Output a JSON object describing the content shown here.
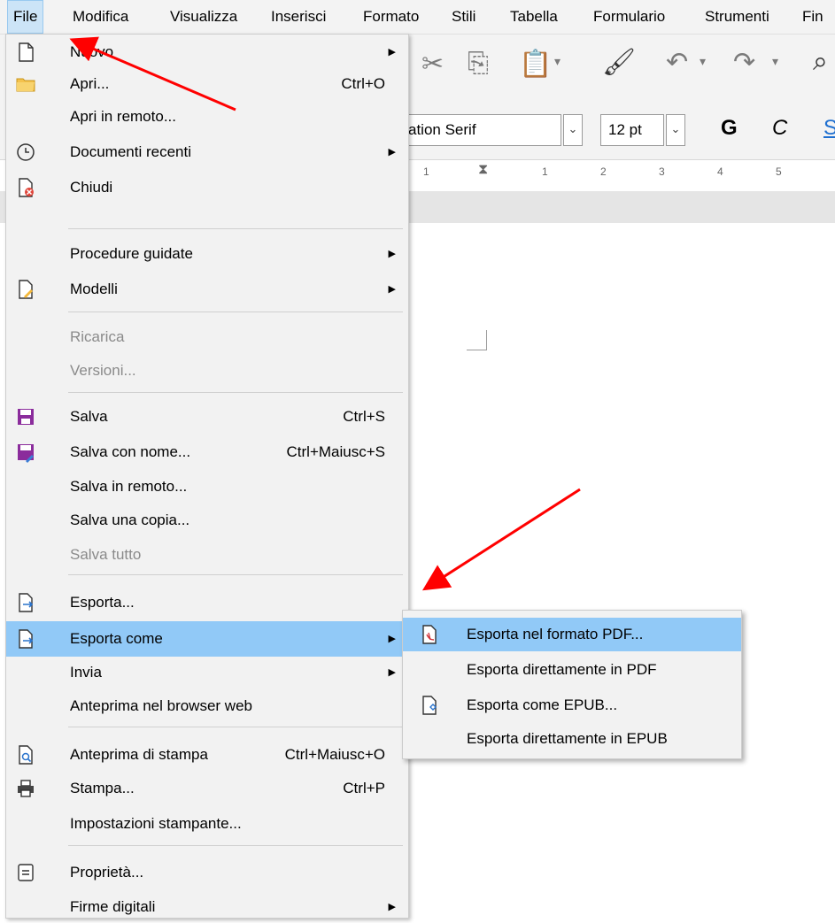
{
  "menubar": {
    "items": [
      "File",
      "Modifica",
      "Visualizza",
      "Inserisci",
      "Formato",
      "Stili",
      "Tabella",
      "Formulario",
      "Strumenti",
      "Fin"
    ]
  },
  "toolbar": {
    "font_name": "ation Serif",
    "font_size": "12 pt",
    "bold_glyph": "G",
    "italic_glyph": "C",
    "underline_glyph": "S"
  },
  "ruler": {
    "ticks": [
      "1",
      "1",
      "2",
      "3",
      "4",
      "5"
    ]
  },
  "file_menu": {
    "items": [
      {
        "label": "Nuovo",
        "icon": "new-document-icon",
        "submenu": true
      },
      {
        "label": "Apri...",
        "icon": "open-folder-icon",
        "shortcut": "Ctrl+O"
      },
      {
        "label": "Apri in remoto..."
      },
      {
        "label": "Documenti recenti",
        "icon": "clock-icon",
        "submenu": true
      },
      {
        "label": "Chiudi",
        "icon": "close-document-icon"
      },
      {
        "label": "Procedure guidate",
        "submenu": true
      },
      {
        "label": "Modelli",
        "icon": "template-icon",
        "submenu": true
      },
      {
        "label": "Ricarica",
        "disabled": true
      },
      {
        "label": "Versioni...",
        "disabled": true
      },
      {
        "label": "Salva",
        "icon": "save-icon",
        "shortcut": "Ctrl+S"
      },
      {
        "label": "Salva con nome...",
        "icon": "save-as-icon",
        "shortcut": "Ctrl+Maiusc+S"
      },
      {
        "label": "Salva in remoto..."
      },
      {
        "label": "Salva una copia..."
      },
      {
        "label": "Salva tutto",
        "disabled": true
      },
      {
        "label": "Esporta...",
        "icon": "export-icon"
      },
      {
        "label": "Esporta come",
        "icon": "export-as-icon",
        "submenu": true,
        "highlighted": true
      },
      {
        "label": "Invia",
        "submenu": true
      },
      {
        "label": "Anteprima nel browser web"
      },
      {
        "label": "Anteprima di stampa",
        "icon": "print-preview-icon",
        "shortcut": "Ctrl+Maiusc+O"
      },
      {
        "label": "Stampa...",
        "icon": "printer-icon",
        "shortcut": "Ctrl+P"
      },
      {
        "label": "Impostazioni stampante..."
      },
      {
        "label": "Proprietà...",
        "icon": "properties-icon"
      },
      {
        "label": "Firme digitali",
        "submenu": true
      }
    ]
  },
  "export_submenu": {
    "items": [
      {
        "label": "Esporta nel formato PDF...",
        "icon": "pdf-icon",
        "highlighted": true
      },
      {
        "label": "Esporta direttamente in PDF"
      },
      {
        "label": "Esporta come EPUB...",
        "icon": "epub-icon"
      },
      {
        "label": "Esporta direttamente in EPUB"
      }
    ]
  },
  "colors": {
    "highlight": "#91c9f7",
    "menu_bg": "#f2f2f2",
    "annotation_arrow": "#ff0000",
    "save_icon": "#8b2c9c"
  }
}
